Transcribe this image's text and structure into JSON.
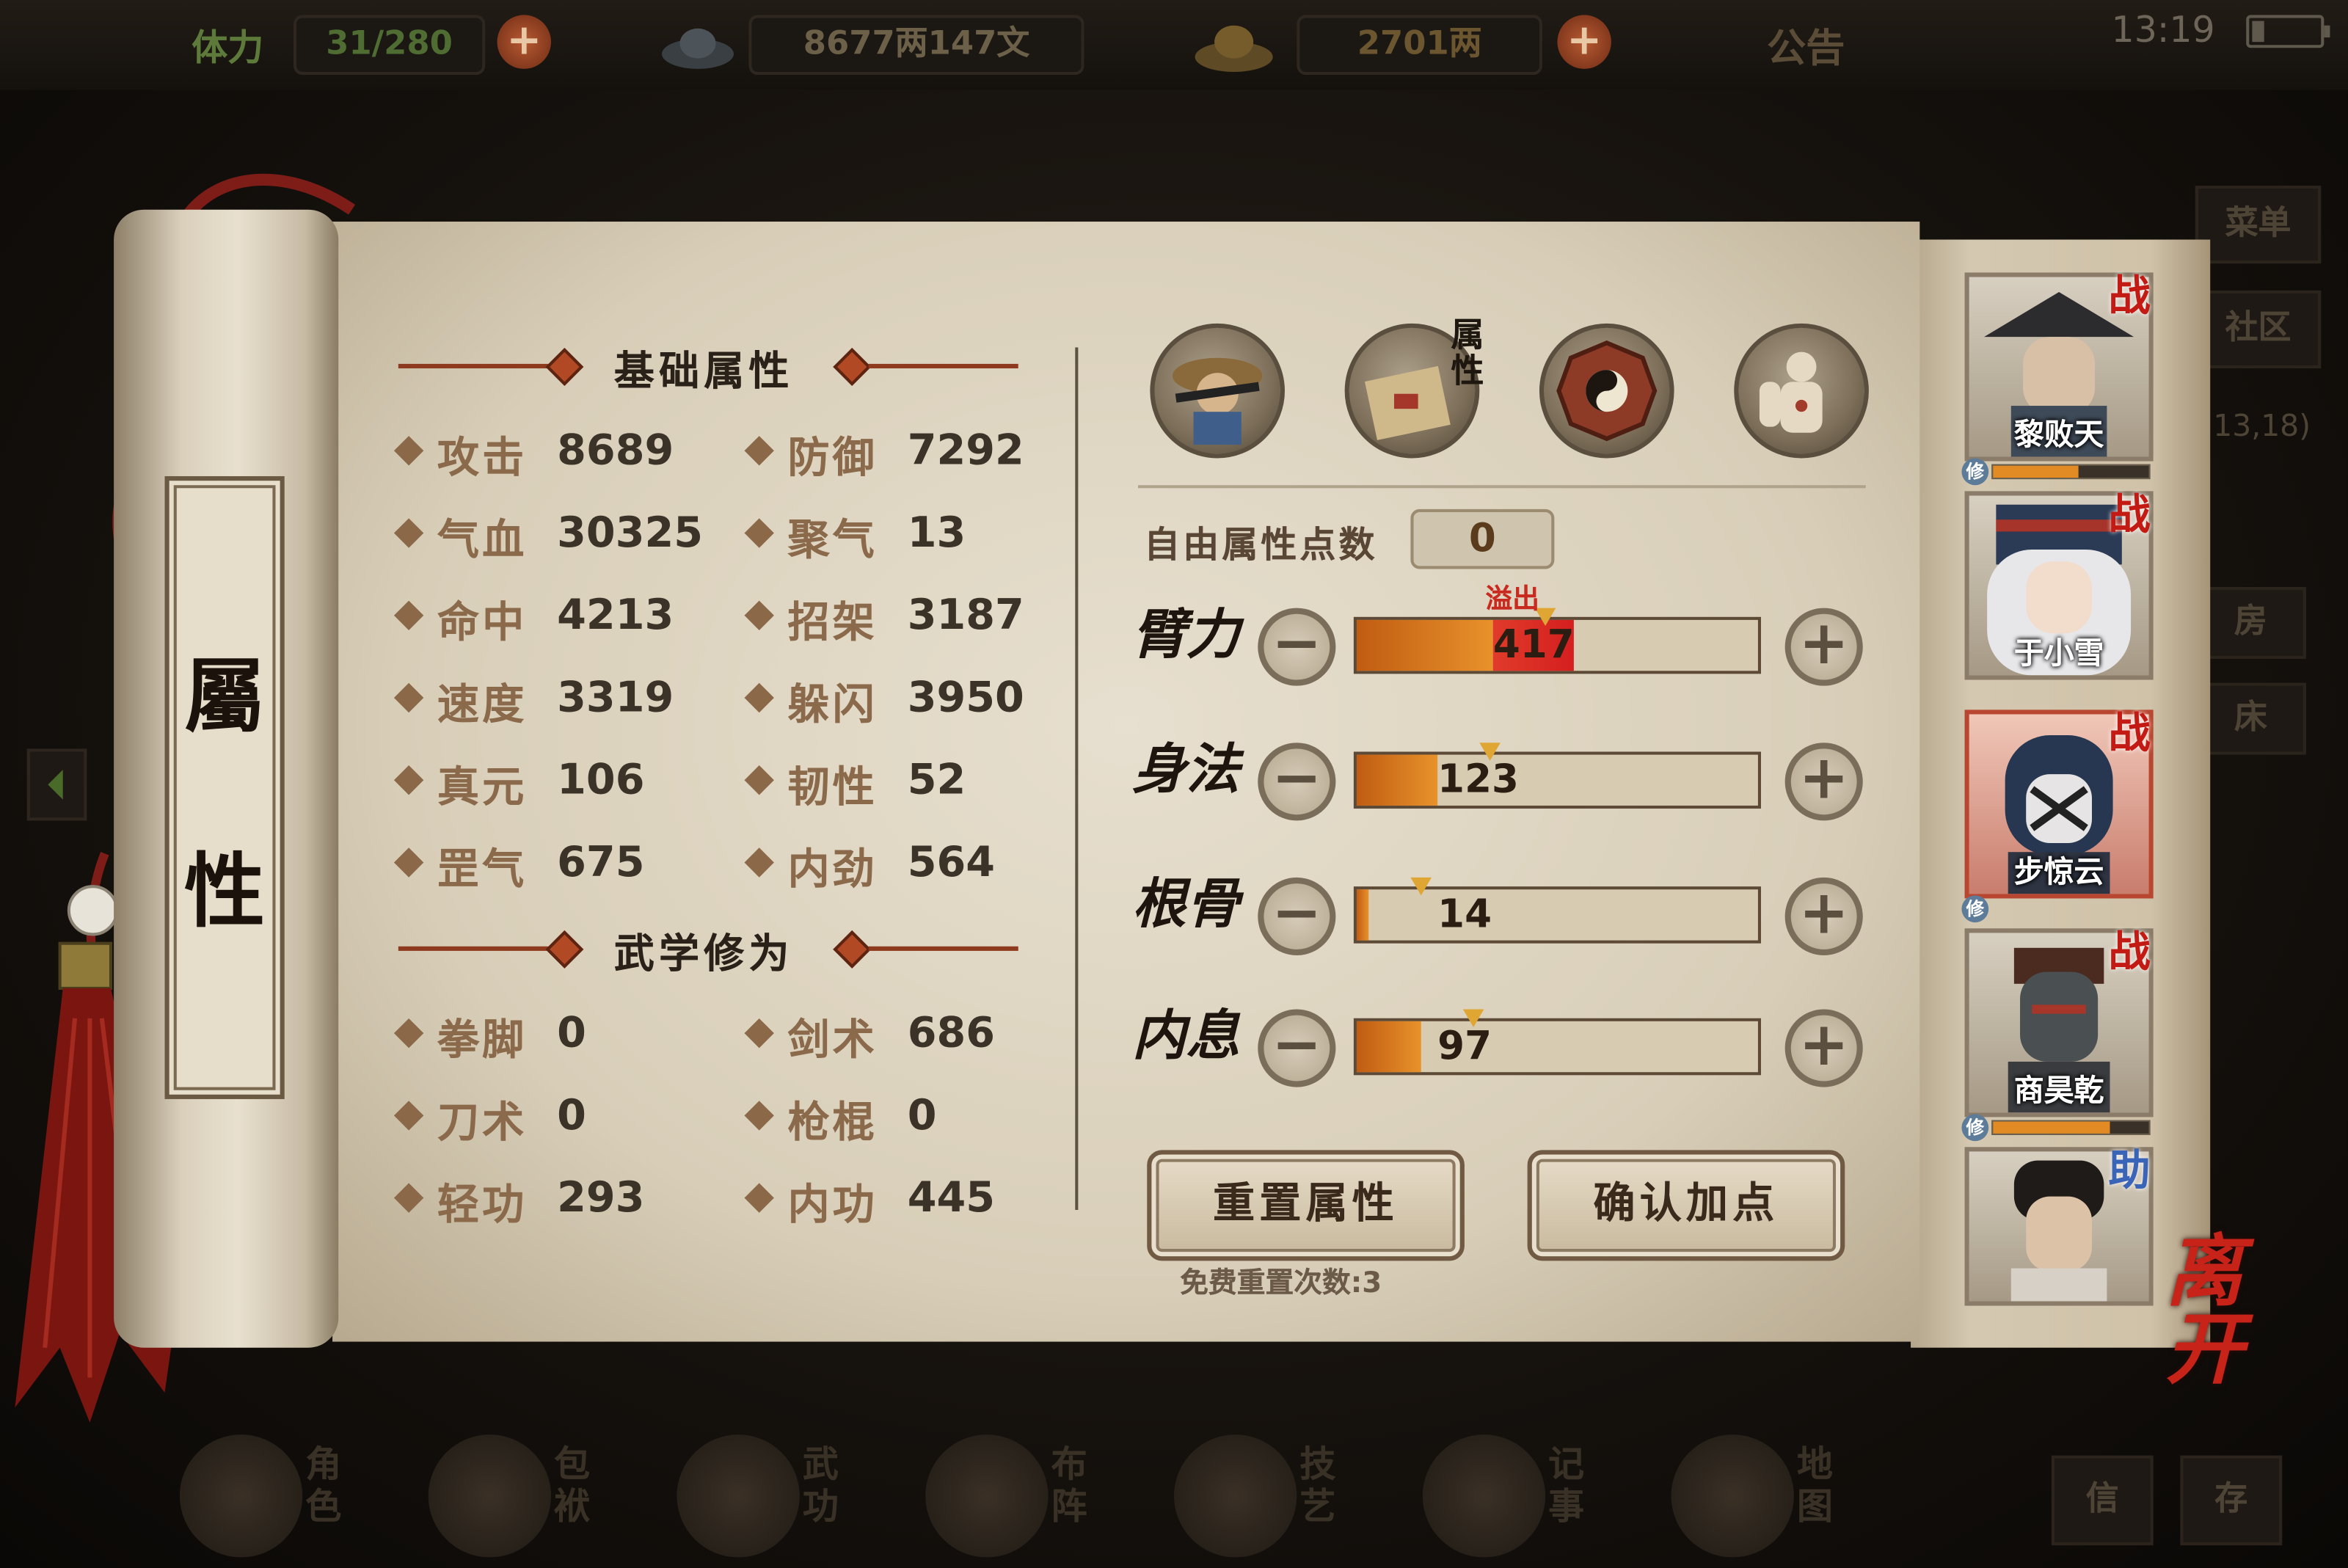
{
  "topbar": {
    "stamina_label": "体力",
    "stamina_value": "31/280",
    "silver_value": "8677两147文",
    "gold_value": "2701两",
    "notice_label": "公告",
    "time": "13:19"
  },
  "right_dim_menu": {
    "menu": "菜单",
    "community": "社区",
    "coords": "13,18)",
    "room": "房",
    "bed": "床"
  },
  "scroll_title": [
    "屬",
    "性"
  ],
  "basic": {
    "title": "基础属性",
    "stats": [
      {
        "name": "攻击",
        "value": "8689"
      },
      {
        "name": "防御",
        "value": "7292"
      },
      {
        "name": "气血",
        "value": "30325"
      },
      {
        "name": "聚气",
        "value": "13"
      },
      {
        "name": "命中",
        "value": "4213"
      },
      {
        "name": "招架",
        "value": "3187"
      },
      {
        "name": "速度",
        "value": "3319"
      },
      {
        "name": "躲闪",
        "value": "3950"
      },
      {
        "name": "真元",
        "value": "106"
      },
      {
        "name": "韧性",
        "value": "52"
      },
      {
        "name": "罡气",
        "value": "675"
      },
      {
        "name": "内劲",
        "value": "564"
      }
    ]
  },
  "martial": {
    "title": "武学修为",
    "stats": [
      {
        "name": "拳脚",
        "value": "0"
      },
      {
        "name": "剑术",
        "value": "686"
      },
      {
        "name": "刀术",
        "value": "0"
      },
      {
        "name": "枪棍",
        "value": "0"
      },
      {
        "name": "轻功",
        "value": "293"
      },
      {
        "name": "内功",
        "value": "445"
      }
    ]
  },
  "tabs": {
    "attr_tab_label": "属性"
  },
  "free_points": {
    "label": "自由属性点数",
    "value": "0"
  },
  "attributes": [
    {
      "label": "臂力",
      "value": "417",
      "fill": 0.34,
      "overflow": 0.2,
      "overflow_label": "溢出"
    },
    {
      "label": "身法",
      "value": "123",
      "fill": 0.2,
      "overflow": 0
    },
    {
      "label": "根骨",
      "value": "14",
      "fill": 0.03,
      "overflow": 0
    },
    {
      "label": "内息",
      "value": "97",
      "fill": 0.16,
      "overflow": 0
    }
  ],
  "buttons": {
    "reset": "重置属性",
    "confirm": "确认加点",
    "free_reset": "免费重置次数:3"
  },
  "party": [
    {
      "name": "黎败天",
      "badge": "战",
      "xiu": "修",
      "xiu_progress": 0.55
    },
    {
      "name": "于小雪",
      "badge": "战"
    },
    {
      "name": "步惊云",
      "badge": "战",
      "xiu": "修",
      "selected": true
    },
    {
      "name": "商昊乾",
      "badge": "战",
      "xiu": "修",
      "xiu_progress": 0.75
    },
    {
      "badge": "助"
    }
  ],
  "leave_label": "离开",
  "bottom_nav": [
    {
      "label": "角色"
    },
    {
      "label": "包袱"
    },
    {
      "label": "武功"
    },
    {
      "label": "布阵"
    },
    {
      "label": "技艺"
    },
    {
      "label": "记事"
    },
    {
      "label": "地图"
    }
  ],
  "bottom_right": {
    "a": "信",
    "b": "存"
  },
  "colors": {
    "overflow_red": "#d51f1f",
    "bar_orange": "#e8922b",
    "war_red": "#c31a14"
  }
}
